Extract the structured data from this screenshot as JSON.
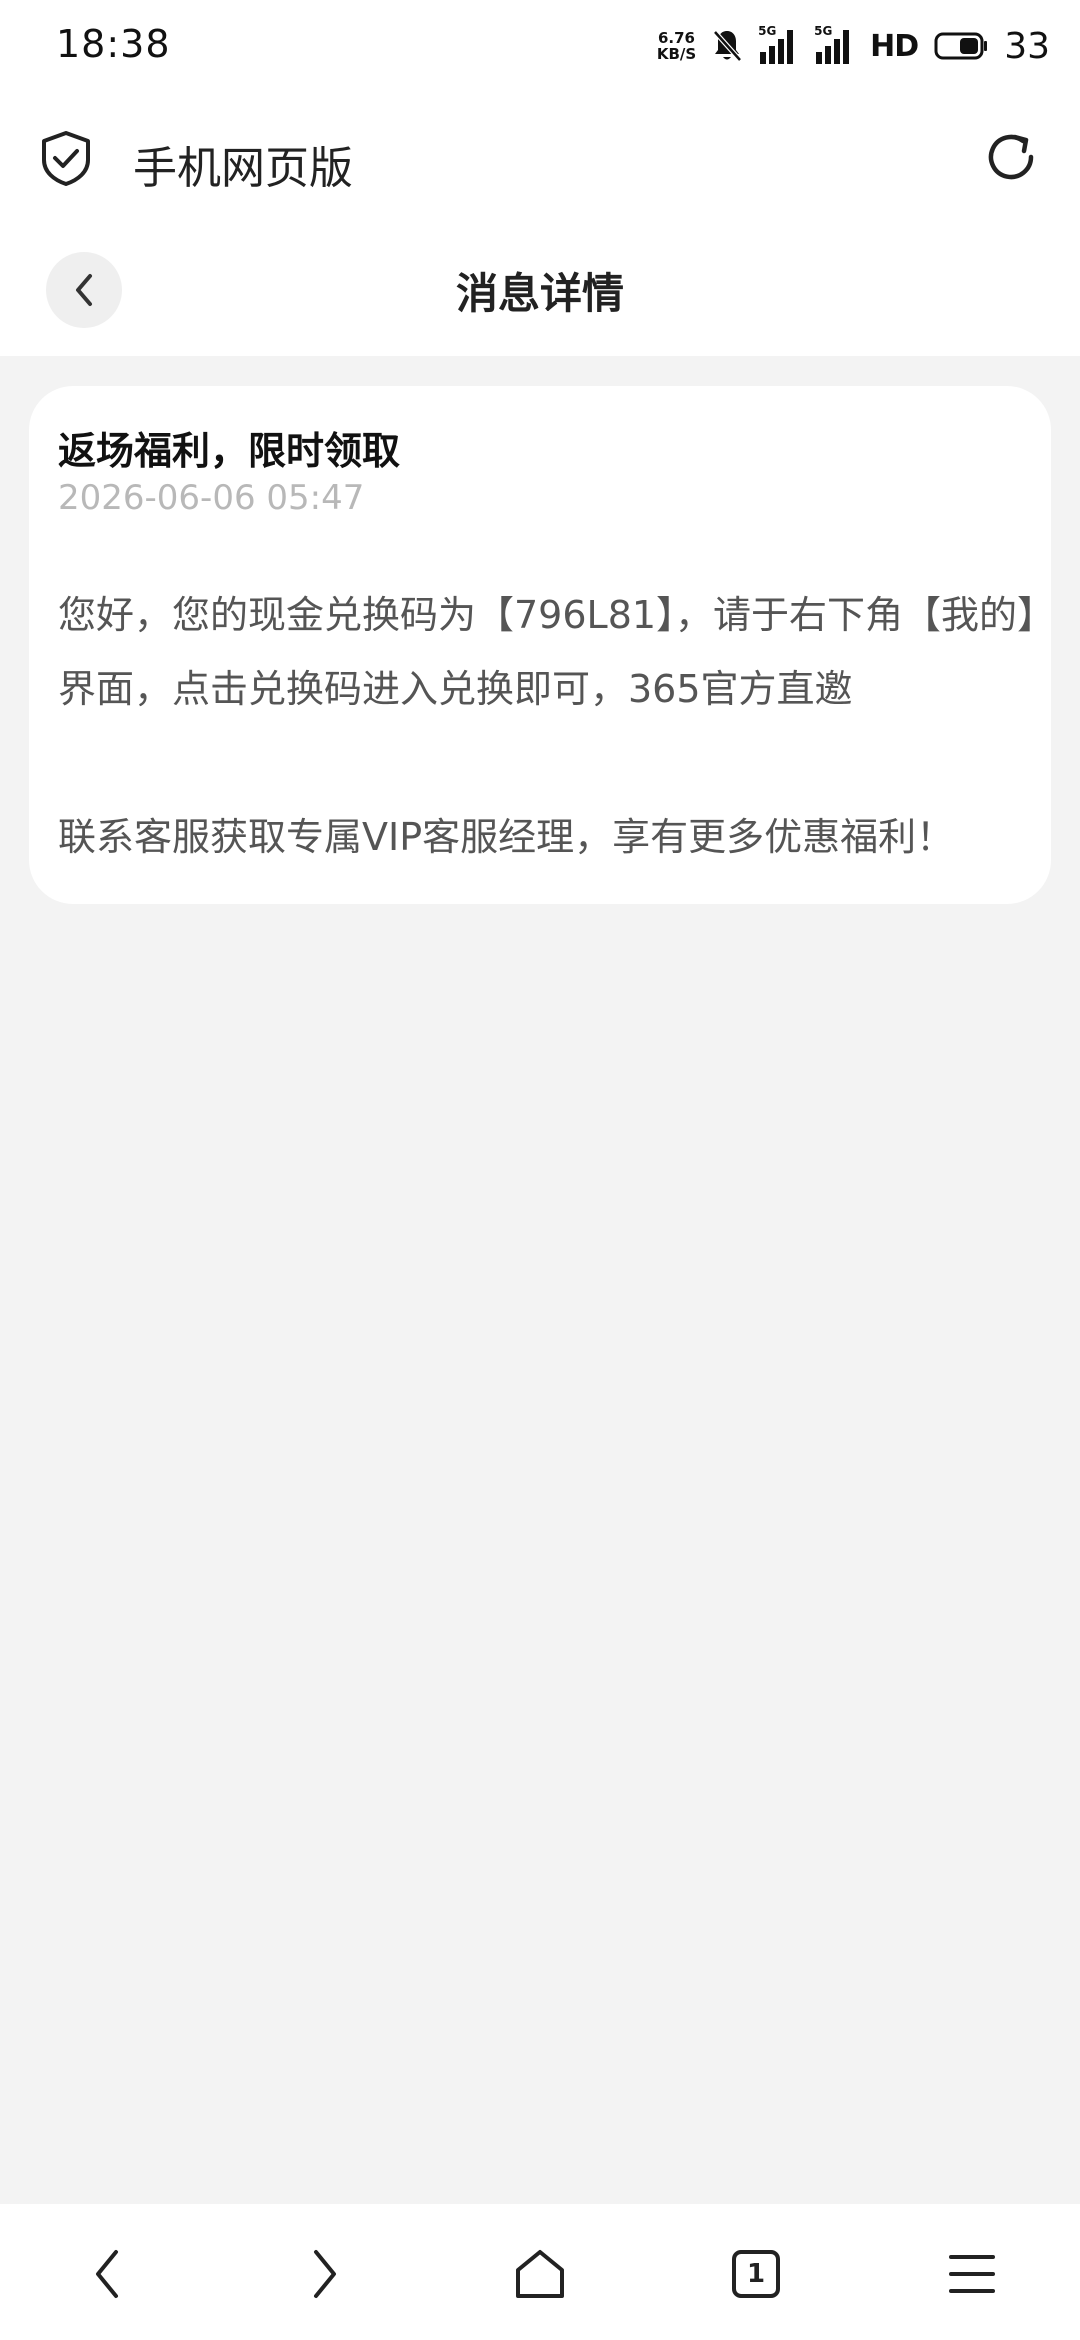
{
  "status_bar": {
    "time": "18:38",
    "net_speed_value": "6.76",
    "net_speed_unit": "KB/S",
    "signal1_label": "5G",
    "signal2_label": "5G",
    "hd_label": "HD",
    "battery_level": "33"
  },
  "browser": {
    "title": "手机网页版",
    "shield_icon": "shield-check-icon",
    "refresh_icon": "refresh-icon"
  },
  "page": {
    "title": "消息详情",
    "back_icon": "chevron-left-icon"
  },
  "message": {
    "title": "返场福利，限时领取",
    "timestamp": "2026-06-06 05:47",
    "body": "您好，您的现金兑换码为【796L81】，请于右下角【我的】界面，点击兑换码进入兑换即可，365官方直邀",
    "extra": "联系客服获取专属VIP客服经理，享有更多优惠福利！"
  },
  "bottom_nav": {
    "tabs_count": "1",
    "icons": [
      "back-arrow-icon",
      "forward-arrow-icon",
      "home-icon",
      "tabs-icon",
      "menu-icon"
    ]
  }
}
